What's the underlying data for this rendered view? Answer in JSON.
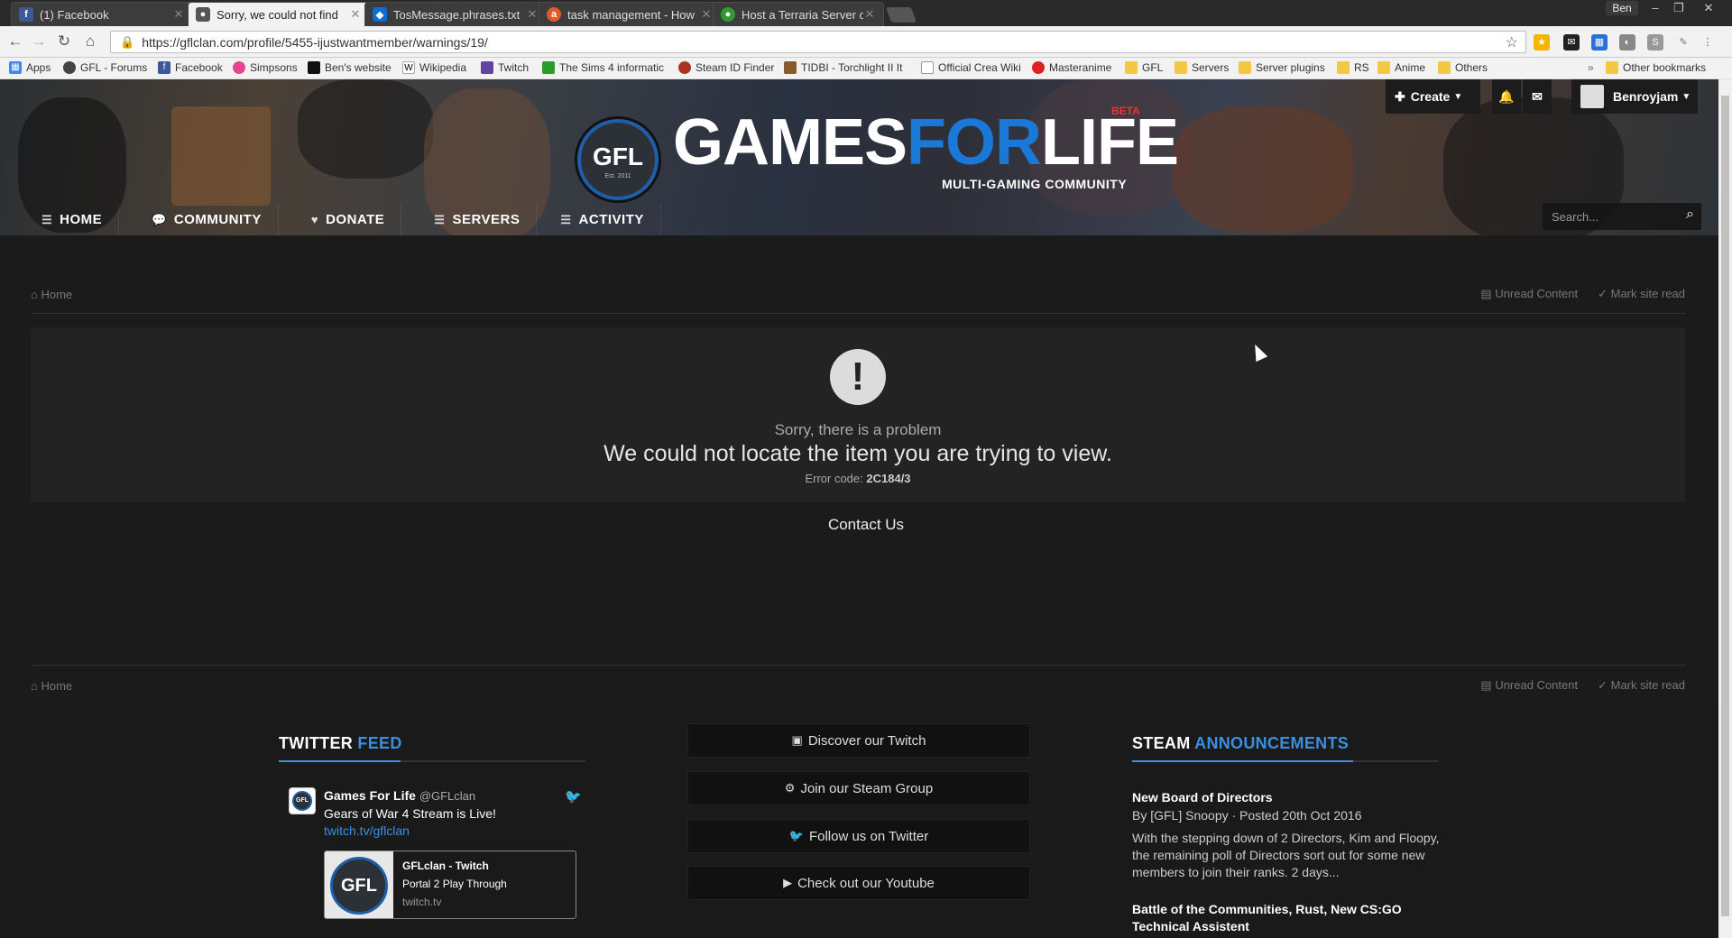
{
  "browser": {
    "tabs": [
      {
        "title": "(1) Facebook",
        "favicon": "facebook-icon",
        "color": "#3b5998",
        "glyph": "f"
      },
      {
        "title": "Sorry, we could not find",
        "favicon": "gfl-icon",
        "color": "#555555",
        "glyph": "●"
      },
      {
        "title": "TosMessage.phrases.txt",
        "favicon": "dropbox-icon",
        "color": "#0d6bd8",
        "glyph": "◆"
      },
      {
        "title": "task management - How",
        "favicon": "askubuntu-icon",
        "color": "#e05a26",
        "glyph": "a"
      },
      {
        "title": "Host a Terraria Server on",
        "favicon": "terraria-icon",
        "color": "#2f9a2f",
        "glyph": "●"
      }
    ],
    "active_tab": 1,
    "user": "Ben",
    "url": "https://gflclan.com/profile/5455-ijustwantmember/warnings/19/",
    "bookmarks": [
      {
        "label": "Apps",
        "icon": "apps-icon"
      },
      {
        "label": "GFL - Forums",
        "icon": "gfl-icon"
      },
      {
        "label": "Facebook",
        "icon": "facebook-icon"
      },
      {
        "label": "Simpsons",
        "icon": "simpsons-icon"
      },
      {
        "label": "Ben's website",
        "icon": "site-icon"
      },
      {
        "label": "Wikipedia",
        "icon": "wikipedia-icon"
      },
      {
        "label": "Twitch",
        "icon": "twitch-icon"
      },
      {
        "label": "The Sims 4 informatic",
        "icon": "sims-icon"
      },
      {
        "label": "Steam ID Finder",
        "icon": "steam-icon"
      },
      {
        "label": "TIDBI - Torchlight II It",
        "icon": "torchlight-icon"
      },
      {
        "label": "Official Crea Wiki",
        "icon": "page-icon"
      },
      {
        "label": "Masteranime",
        "icon": "masteranime-icon"
      },
      {
        "label": "GFL",
        "icon": "folder-icon"
      },
      {
        "label": "Servers",
        "icon": "folder-icon"
      },
      {
        "label": "Server plugins",
        "icon": "folder-icon"
      },
      {
        "label": "RS",
        "icon": "folder-icon"
      },
      {
        "label": "Anime",
        "icon": "folder-icon"
      },
      {
        "label": "Others",
        "icon": "folder-icon"
      }
    ],
    "bookmarks_overflow": "»",
    "other_bookmarks": "Other bookmarks"
  },
  "site": {
    "logo": {
      "badge": "GFL",
      "badge_sub": "Est. 2011",
      "word1": "GAMES",
      "word2": "FOR",
      "word3": "LIFE",
      "beta": "BETA",
      "tagline": "MULTI-GAMING COMMUNITY"
    },
    "user_menu": {
      "create": "Create",
      "username": "Benroyjam"
    },
    "nav": [
      {
        "label": "HOME",
        "icon": "list-icon"
      },
      {
        "label": "COMMUNITY",
        "icon": "chat-icon"
      },
      {
        "label": "DONATE",
        "icon": "heart-icon"
      },
      {
        "label": "SERVERS",
        "icon": "list-icon"
      },
      {
        "label": "ACTIVITY",
        "icon": "list-icon"
      }
    ],
    "search_placeholder": "Search..."
  },
  "breadcrumb": {
    "home": "Home",
    "unread": "Unread Content",
    "mark_read": "Mark site read"
  },
  "error": {
    "title": "Sorry, there is a problem",
    "message": "We could not locate the item you are trying to view.",
    "code_label": "Error code:",
    "code": "2C184/3",
    "contact": "Contact Us"
  },
  "footer": {
    "twitter_title_1": "TWITTER",
    "twitter_title_2": "FEED",
    "tweet": {
      "name": "Games For Life",
      "handle": "@GFLclan",
      "text": "Gears of War 4 Stream is Live!",
      "link": "twitch.tv/gflclan",
      "card_title": "GFLclan - Twitch",
      "card_desc": "Portal 2 Play Through",
      "card_domain": "twitch.tv"
    },
    "buttons": [
      {
        "label": "Discover our Twitch",
        "icon": "twitch-icon"
      },
      {
        "label": "Join our Steam Group",
        "icon": "steam-icon"
      },
      {
        "label": "Follow us on Twitter",
        "icon": "twitter-icon"
      },
      {
        "label": "Check out our Youtube",
        "icon": "youtube-icon"
      }
    ],
    "steam_title_1": "STEAM",
    "steam_title_2": "ANNOUNCEMENTS",
    "announcements": [
      {
        "title": "New Board of Directors",
        "meta": "By [GFL] Snoopy · Posted 20th Oct 2016",
        "excerpt": "With the stepping down of 2 Directors, Kim and Floopy, the remaining poll of Directors sort out for some new members to join their ranks. 2 days..."
      },
      {
        "title": "Battle of the Communities, Rust, New CS:GO Technical Assistent"
      }
    ]
  },
  "colors": {
    "accent": "#3b8fe0",
    "logo_blue": "#1a78d8",
    "beta": "#e33333",
    "background": "#1b1b1b"
  }
}
